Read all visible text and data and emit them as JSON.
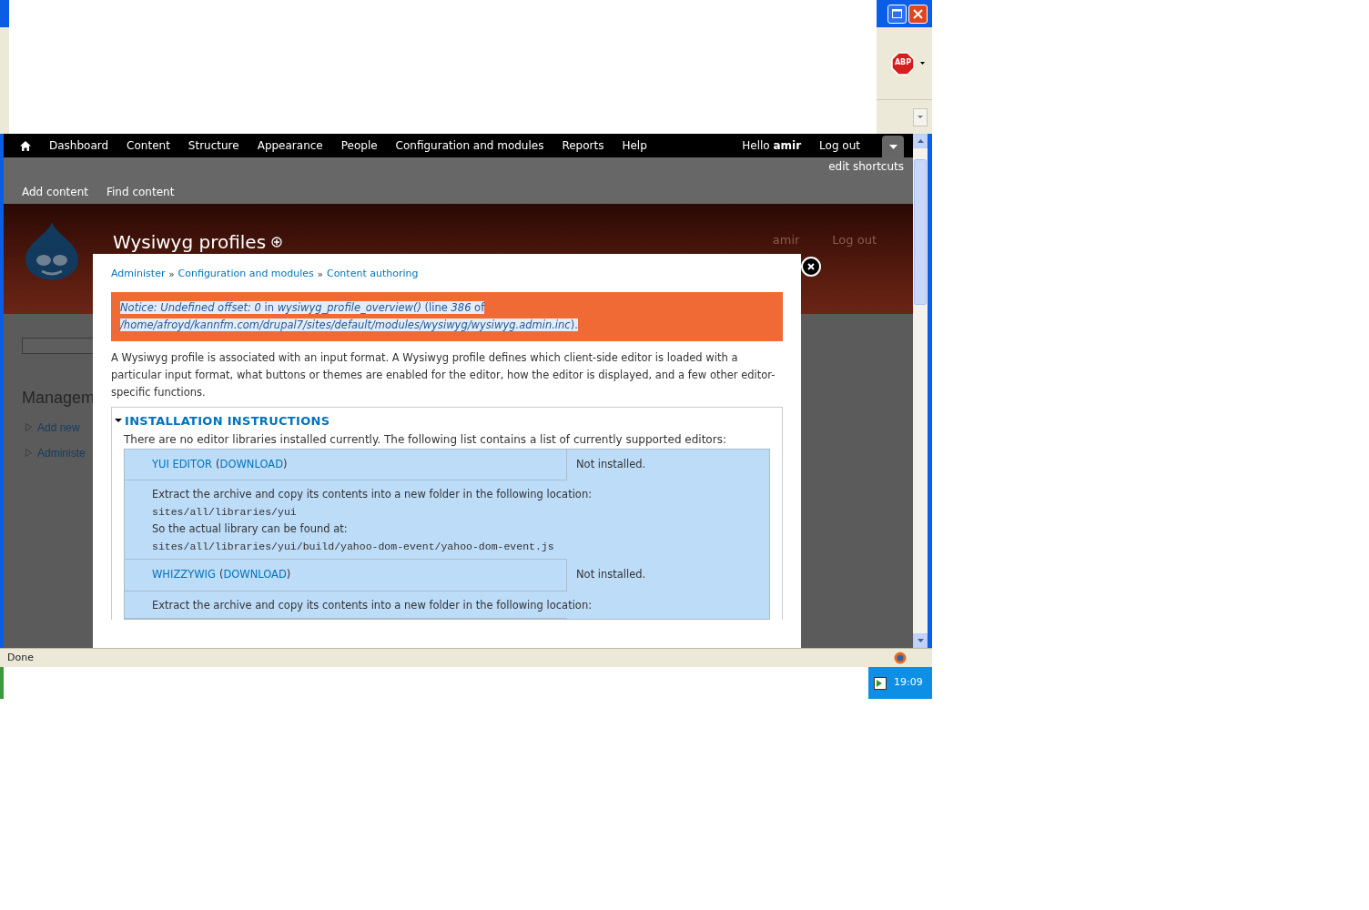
{
  "browser": {
    "abp_label": "ABP",
    "status": "Done",
    "clock": "19:09"
  },
  "toolbar": {
    "menu": [
      {
        "label": "Dashboard"
      },
      {
        "label": "Content"
      },
      {
        "label": "Structure"
      },
      {
        "label": "Appearance"
      },
      {
        "label": "People"
      },
      {
        "label": "Configuration and modules"
      },
      {
        "label": "Reports"
      },
      {
        "label": "Help"
      }
    ],
    "greeting": "Hello **amir**",
    "logout": "Log out",
    "edit_shortcuts": "edit shortcuts",
    "shortcuts": [
      {
        "label": "Add content"
      },
      {
        "label": "Find content"
      }
    ]
  },
  "page": {
    "title": "Wysiwyg profiles",
    "user_links": [
      "amir",
      "Log out"
    ],
    "sidebar_heading": "Managem",
    "sidebar_links": [
      "Add new",
      "Administe"
    ]
  },
  "dialog": {
    "breadcrumb": {
      "links": [
        "Administer",
        "Configuration and modules",
        "Content authoring"
      ],
      "separators": [
        "»",
        "»"
      ]
    },
    "message": {
      "text": "*Notice: Undefined offset: 0* in *wysiwyg_profile_overview()* (line *386* of */home/afroyd/kannfm.com/drupal7/sites/default/modules/wysiwyg/wysiwyg.admin.inc*).",
      "selected": true
    },
    "description": "A Wysiwyg profile is associated with an input format. A Wysiwyg profile defines which client-side editor is loaded with a particular input format, what buttons or themes are enabled for the editor, how the editor is displayed, and a few other editor-specific functions.",
    "fieldset": {
      "legend": "INSTALLATION INSTRUCTIONS",
      "expanded": true,
      "intro": "There are no editor libraries installed currently. The following list contains a list of currently supported editors:",
      "editors": [
        {
          "name": "YUI EDITOR",
          "download": "DOWNLOAD",
          "brackets": [
            "(",
            ")"
          ],
          "status": "Not installed.",
          "instructions": [
            {
              "kind": "text",
              "text": "Extract the archive and copy its contents into a new folder in the following location:"
            },
            {
              "kind": "code",
              "text": "sites/all/libraries/yui"
            },
            {
              "kind": "text",
              "text": "So the actual library can be found at:"
            },
            {
              "kind": "code",
              "text": "sites/all/libraries/yui/build/yahoo-dom-event/yahoo-dom-event.js"
            }
          ]
        },
        {
          "name": "WHIZZYWIG",
          "download": "DOWNLOAD",
          "brackets": [
            "(",
            ")"
          ],
          "status": "Not installed.",
          "instructions": [
            {
              "kind": "text",
              "text": "Extract the archive and copy its contents into a new folder in the following location:"
            }
          ]
        }
      ]
    }
  }
}
